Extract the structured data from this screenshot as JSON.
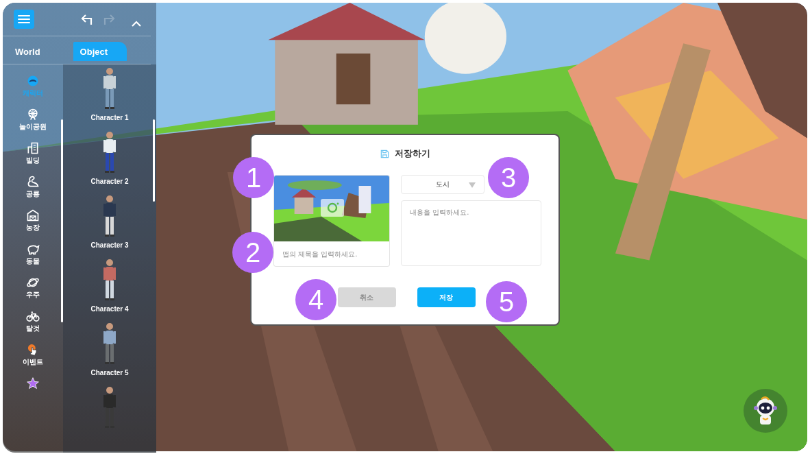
{
  "sidebar": {
    "undo": {
      "disabled": false
    },
    "redo": {
      "disabled": true
    },
    "tabs": [
      {
        "label": "World",
        "selected": false
      },
      {
        "label": "Object",
        "selected": true
      }
    ],
    "categories": [
      {
        "kind": "character",
        "label": "캐릭터",
        "selected": true
      },
      {
        "kind": "ferris-wheel",
        "label": "놀이공원",
        "selected": false
      },
      {
        "kind": "building",
        "label": "빌딩",
        "selected": false
      },
      {
        "kind": "dinosaur",
        "label": "공룡",
        "selected": false
      },
      {
        "kind": "barn",
        "label": "농장",
        "selected": false
      },
      {
        "kind": "animal",
        "label": "동물",
        "selected": false
      },
      {
        "kind": "planet",
        "label": "우주",
        "selected": false
      },
      {
        "kind": "bicycle",
        "label": "탈것",
        "selected": false
      },
      {
        "kind": "event",
        "label": "이벤트",
        "selected": false
      },
      {
        "kind": "star",
        "selected": false
      }
    ],
    "items": [
      {
        "kind": "character",
        "label": "Character 1"
      },
      {
        "kind": "character",
        "label": "Character 2"
      },
      {
        "kind": "character",
        "label": "Character 3"
      },
      {
        "kind": "character",
        "label": "Character 4"
      },
      {
        "kind": "character",
        "label": "Character 5"
      },
      {
        "kind": "character"
      }
    ]
  },
  "dialog": {
    "title": "저장하기",
    "map_title": {
      "placeholder": "맵의 제목을 입력하세요."
    },
    "category": {
      "value": "도시"
    },
    "description": {
      "placeholder": "내용을 입력하세요."
    },
    "buttons": [
      {
        "kind": "cancel",
        "label": "취소",
        "disabled": true
      },
      {
        "kind": "save",
        "label": "저장",
        "disabled": false
      }
    ]
  },
  "markers": [
    "1",
    "2",
    "3",
    "4",
    "5"
  ]
}
